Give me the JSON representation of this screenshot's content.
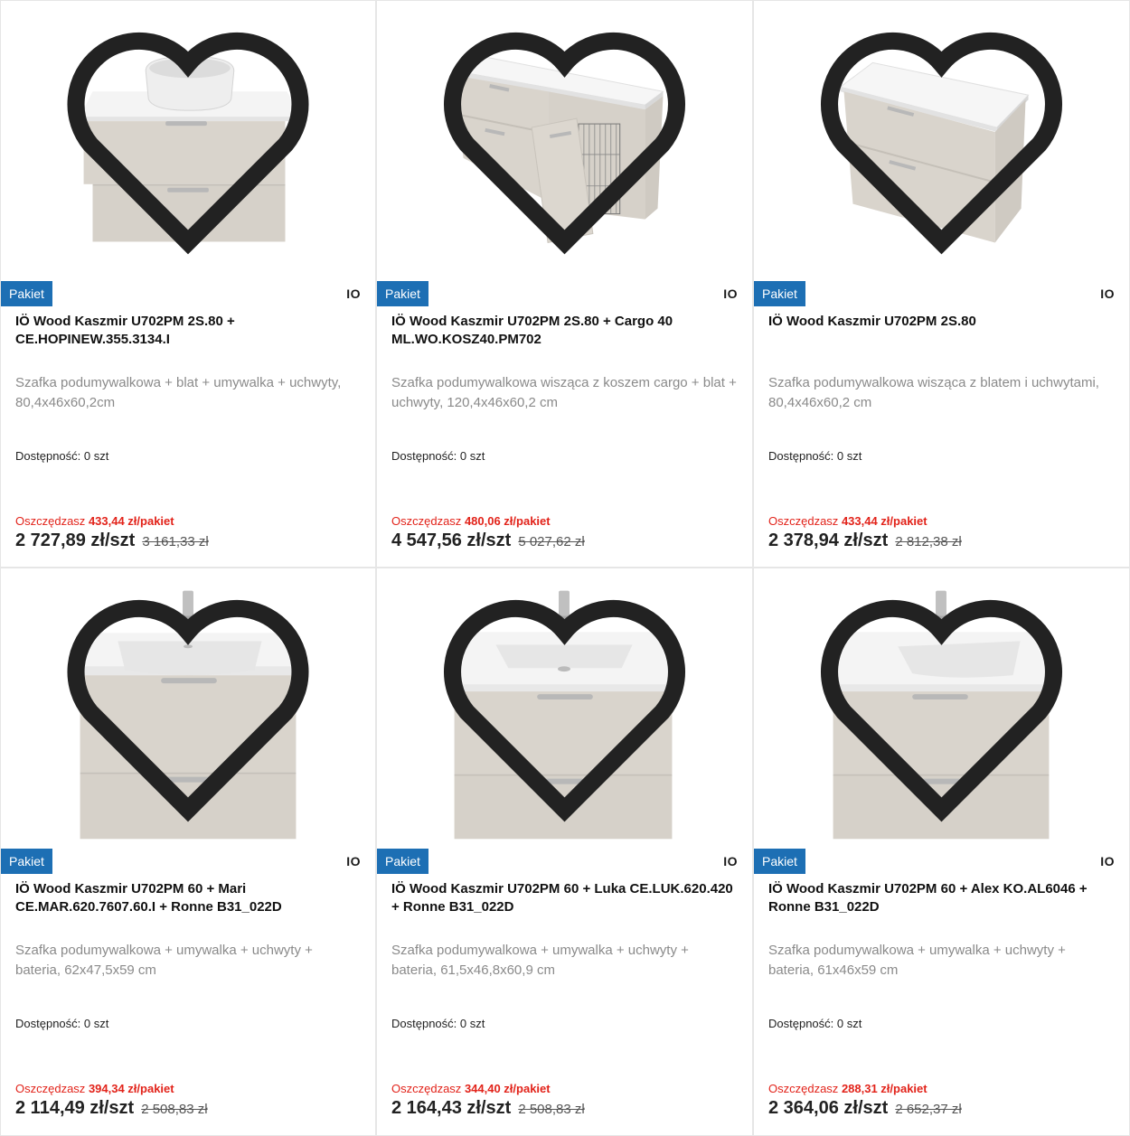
{
  "colors": {
    "badge_bg": "#1d6fb4",
    "savings": "#e2231a",
    "cabinet": "#d8d3cb",
    "countertop": "#f2f2f2"
  },
  "products": [
    {
      "image_kind": "vessel-sink-cabinet",
      "badge": "Pakiet",
      "brand": "IO",
      "title": "IÖ Wood Kaszmir U702PM 2S.80 + CE.HOPINEW.355.3134.I",
      "description": "Szafka podumywalkowa + blat + umywalka + uchwyty, 80,4x46x60,2cm",
      "availability": "Dostępność: 0 szt",
      "savings_label": "Oszczędzasz",
      "savings_value": "433,44 zł/pakiet",
      "price": "2 727,89 zł/szt",
      "old_price": "3 161,33 zł"
    },
    {
      "image_kind": "cargo-cabinet",
      "badge": "Pakiet",
      "brand": "IO",
      "title": "IÖ Wood Kaszmir U702PM 2S.80 + Cargo 40 ML.WO.KOSZ40.PM702",
      "description": "Szafka podumywalkowa wisząca z koszem cargo + blat + uchwyty, 120,4x46x60,2 cm",
      "availability": "Dostępność: 0 szt",
      "savings_label": "Oszczędzasz",
      "savings_value": "480,06 zł/pakiet",
      "price": "4 547,56 zł/szt",
      "old_price": "5 027,62 zł"
    },
    {
      "image_kind": "plain-cabinet",
      "badge": "Pakiet",
      "brand": "IO",
      "title": "IÖ Wood Kaszmir U702PM 2S.80",
      "description": "Szafka podumywalkowa wisząca z blatem i uchwytami, 80,4x46x60,2 cm",
      "availability": "Dostępność: 0 szt",
      "savings_label": "Oszczędzasz",
      "savings_value": "433,44 zł/pakiet",
      "price": "2 378,94 zł/szt",
      "old_price": "2 812,38 zł"
    },
    {
      "image_kind": "basin-cabinet",
      "badge": "Pakiet",
      "brand": "IO",
      "title": "IÖ Wood Kaszmir U702PM 60 + Mari CE.MAR.620.7607.60.I + Ronne B31_022D",
      "description": "Szafka podumywalkowa + umywalka + uchwyty + bateria, 62x47,5x59 cm",
      "availability": "Dostępność: 0 szt",
      "savings_label": "Oszczędzasz",
      "savings_value": "394,34 zł/pakiet",
      "price": "2 114,49 zł/szt",
      "old_price": "2 508,83 zł"
    },
    {
      "image_kind": "basin-cabinet",
      "badge": "Pakiet",
      "brand": "IO",
      "title": "IÖ Wood Kaszmir U702PM 60 + Luka CE.LUK.620.420 + Ronne B31_022D",
      "description": "Szafka podumywalkowa + umywalka + uchwyty + bateria, 61,5x46,8x60,9 cm",
      "availability": "Dostępność: 0 szt",
      "savings_label": "Oszczędzasz",
      "savings_value": "344,40 zł/pakiet",
      "price": "2 164,43 zł/szt",
      "old_price": "2 508,83 zł"
    },
    {
      "image_kind": "basin-cabinet",
      "badge": "Pakiet",
      "brand": "IO",
      "title": "IÖ Wood Kaszmir U702PM 60 + Alex KO.AL6046 + Ronne B31_022D",
      "description": "Szafka podumywalkowa + umywalka + uchwyty + bateria, 61x46x59 cm",
      "availability": "Dostępność: 0 szt",
      "savings_label": "Oszczędzasz",
      "savings_value": "288,31 zł/pakiet",
      "price": "2 364,06 zł/szt",
      "old_price": "2 652,37 zł"
    }
  ]
}
